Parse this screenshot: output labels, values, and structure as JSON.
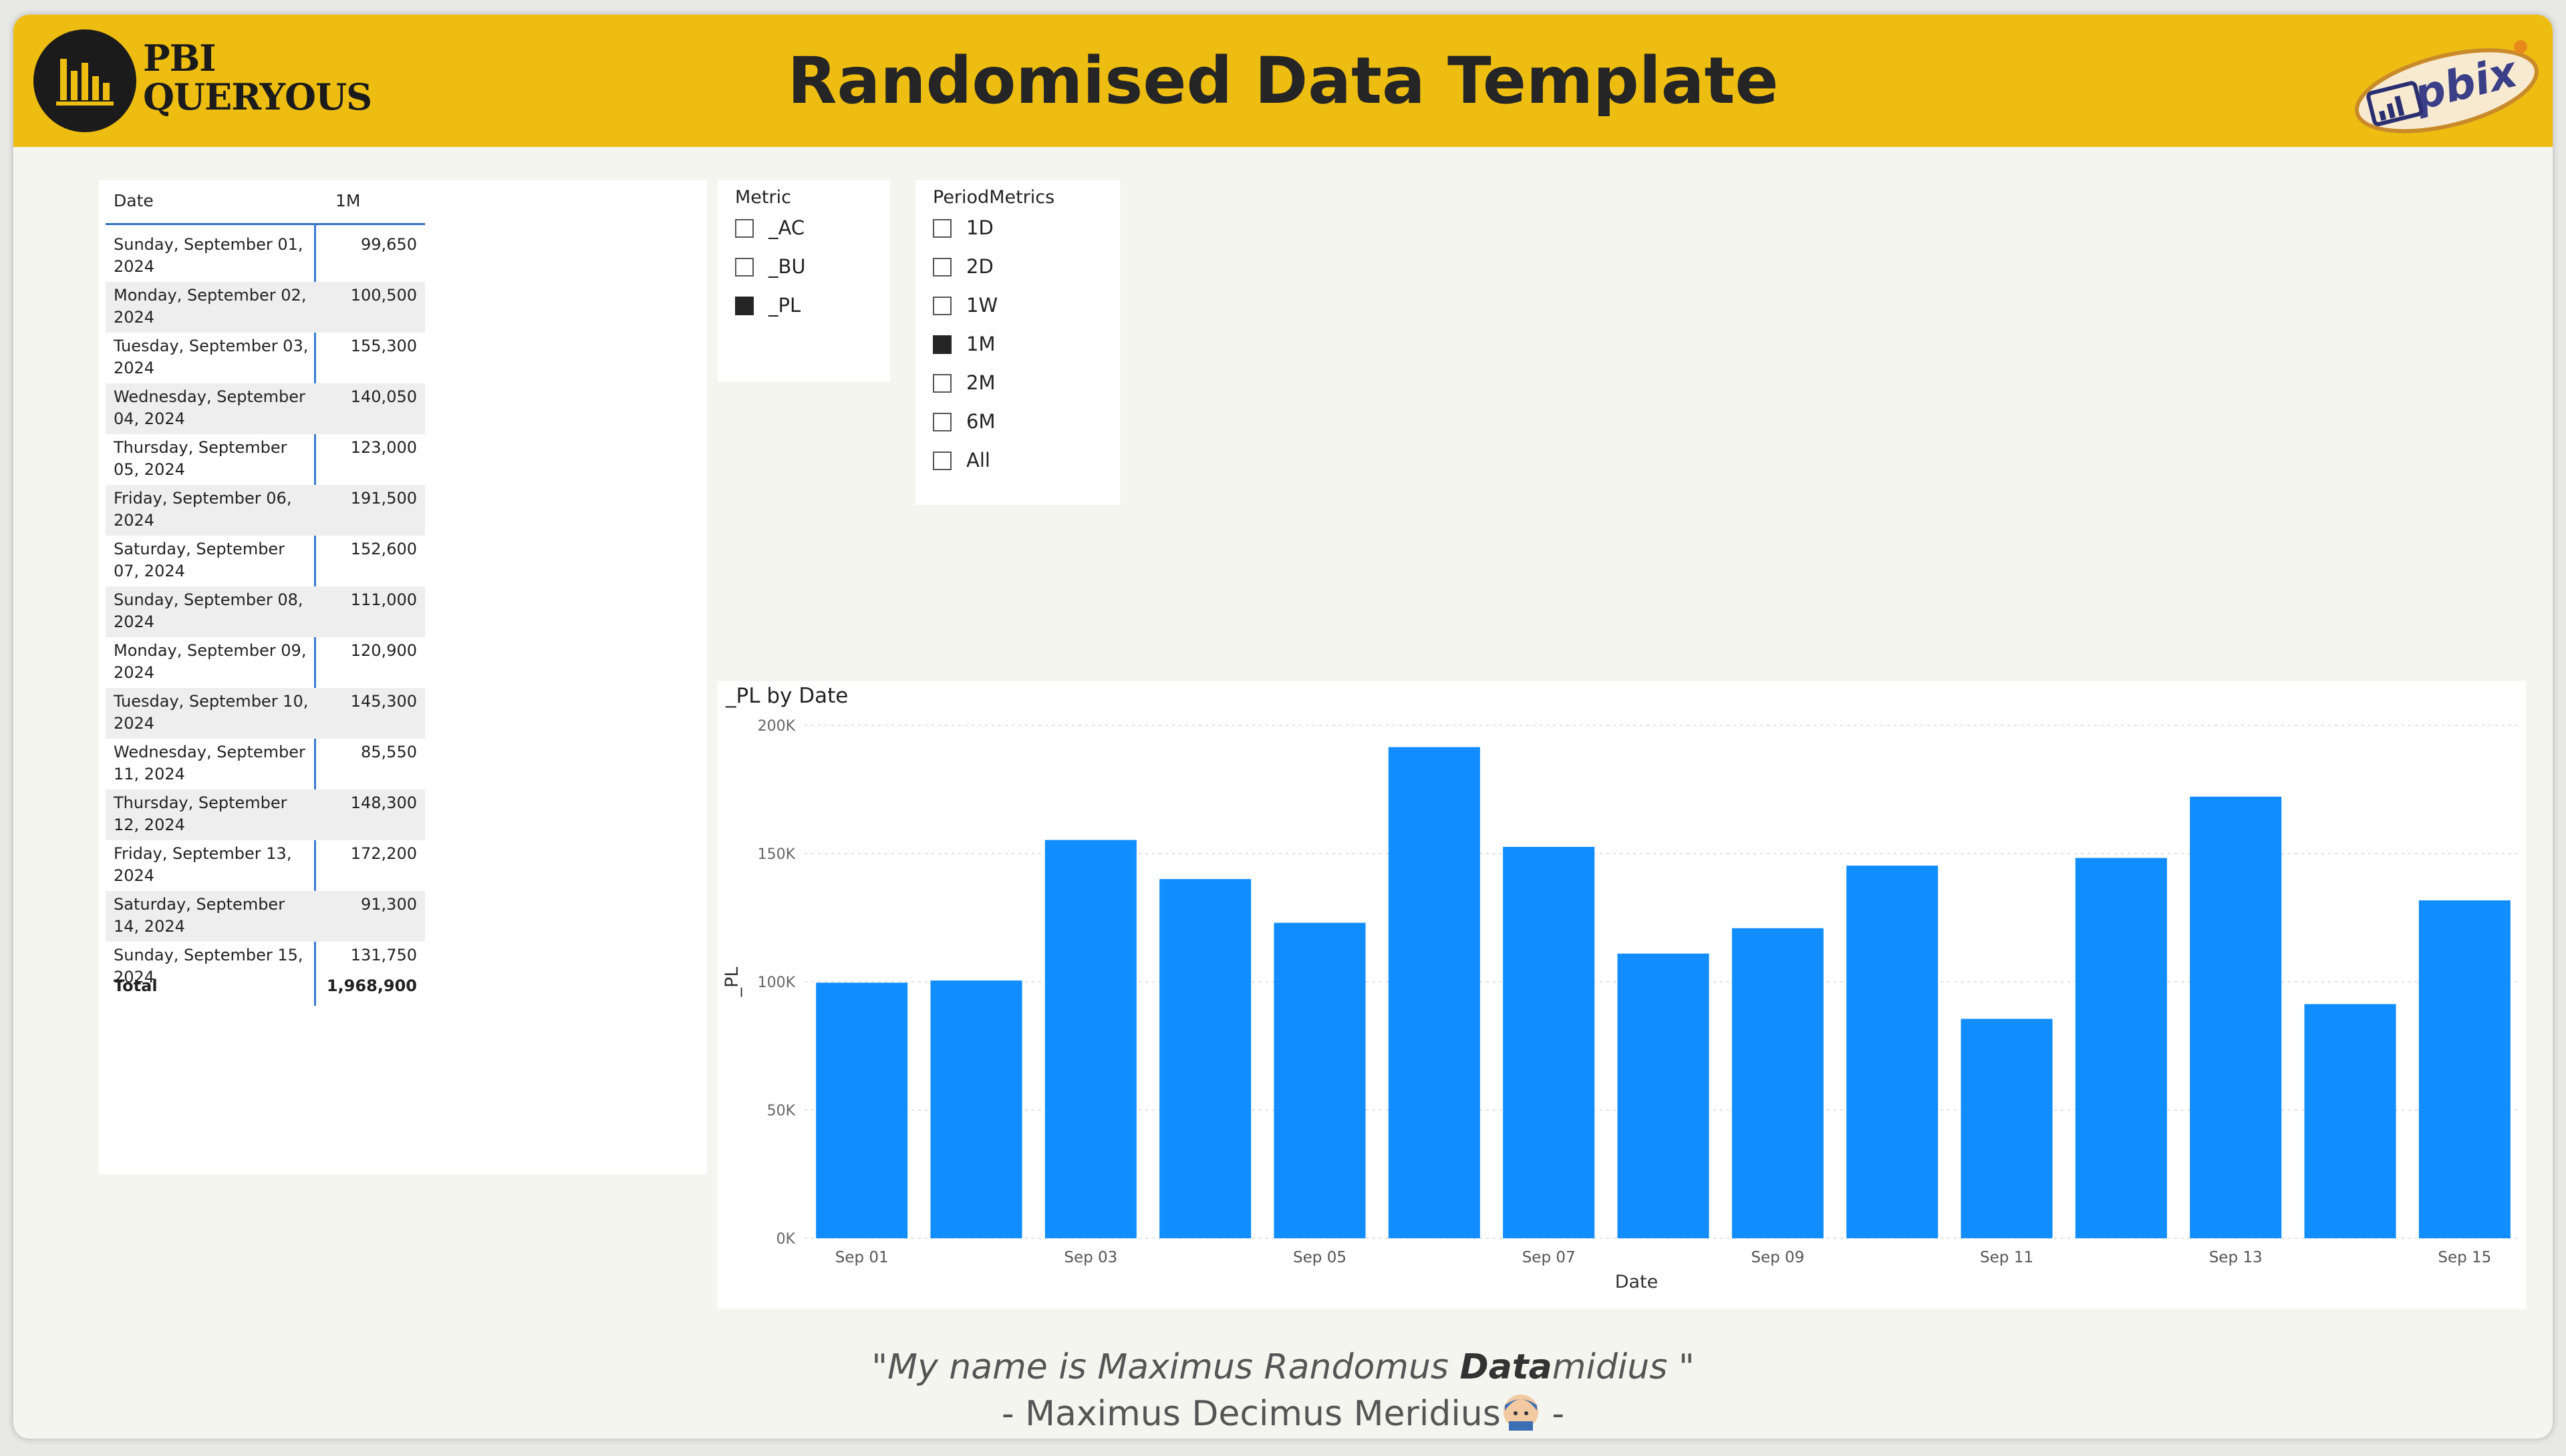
{
  "header": {
    "logo_line1": "PBI",
    "logo_line2": "QUERYOUS",
    "title": "Randomised Data Template",
    "badge_text": "pbix"
  },
  "table": {
    "headers": [
      "Date",
      "1M"
    ],
    "rows": [
      {
        "date": "Sunday, September 01, 2024",
        "value": "99,650"
      },
      {
        "date": "Monday, September 02, 2024",
        "value": "100,500"
      },
      {
        "date": "Tuesday, September 03, 2024",
        "value": "155,300"
      },
      {
        "date": "Wednesday, September 04, 2024",
        "value": "140,050"
      },
      {
        "date": "Thursday, September 05, 2024",
        "value": "123,000"
      },
      {
        "date": "Friday, September 06, 2024",
        "value": "191,500"
      },
      {
        "date": "Saturday, September 07, 2024",
        "value": "152,600"
      },
      {
        "date": "Sunday, September 08, 2024",
        "value": "111,000"
      },
      {
        "date": "Monday, September 09, 2024",
        "value": "120,900"
      },
      {
        "date": "Tuesday, September 10, 2024",
        "value": "145,300"
      },
      {
        "date": "Wednesday, September 11, 2024",
        "value": "85,550"
      },
      {
        "date": "Thursday, September 12, 2024",
        "value": "148,300"
      },
      {
        "date": "Friday, September 13, 2024",
        "value": "172,200"
      },
      {
        "date": "Saturday, September 14, 2024",
        "value": "91,300"
      },
      {
        "date": "Sunday, September 15, 2024",
        "value": "131,750"
      }
    ],
    "total_label": "Total",
    "total_value": "1,968,900"
  },
  "metric_slicer": {
    "title": "Metric",
    "items": [
      {
        "label": "_AC",
        "checked": false
      },
      {
        "label": "_BU",
        "checked": false
      },
      {
        "label": "_PL",
        "checked": true
      }
    ]
  },
  "period_slicer": {
    "title": "PeriodMetrics",
    "items": [
      {
        "label": "1D",
        "checked": false
      },
      {
        "label": "2D",
        "checked": false
      },
      {
        "label": "1W",
        "checked": false
      },
      {
        "label": "1M",
        "checked": true
      },
      {
        "label": "2M",
        "checked": false
      },
      {
        "label": "6M",
        "checked": false
      },
      {
        "label": "All",
        "checked": false
      }
    ]
  },
  "chart_data": {
    "type": "bar",
    "title": "_PL by Date",
    "xlabel": "Date",
    "ylabel": "_PL",
    "ylim": [
      0,
      200000
    ],
    "yticks": [
      "0K",
      "50K",
      "100K",
      "150K",
      "200K"
    ],
    "categories": [
      "Sep 01",
      "Sep 02",
      "Sep 03",
      "Sep 04",
      "Sep 05",
      "Sep 06",
      "Sep 07",
      "Sep 08",
      "Sep 09",
      "Sep 10",
      "Sep 11",
      "Sep 12",
      "Sep 13",
      "Sep 14",
      "Sep 15"
    ],
    "xtick_labels": [
      "Sep 01",
      "",
      "Sep 03",
      "",
      "Sep 05",
      "",
      "Sep 07",
      "",
      "Sep 09",
      "",
      "Sep 11",
      "",
      "Sep 13",
      "",
      "Sep 15"
    ],
    "values": [
      99650,
      100500,
      155300,
      140050,
      123000,
      191500,
      152600,
      111000,
      120900,
      145300,
      85550,
      148300,
      172200,
      91300,
      131750
    ],
    "bar_color": "#118dff",
    "grid": true
  },
  "quote": {
    "line1_prefix": "\"My name is Maximus Randomus ",
    "line1_bold": "Data",
    "line1_suffix": "midius \"",
    "line2": "- Maximus Decimus Meridius",
    "line2_end": " -"
  }
}
